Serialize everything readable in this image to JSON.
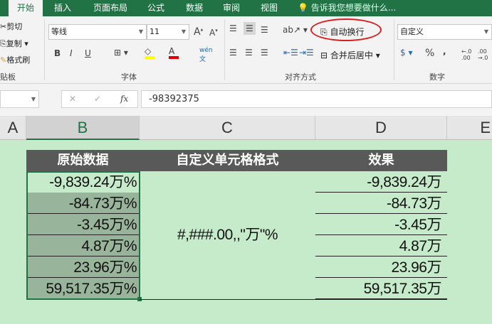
{
  "tabs": [
    "开始",
    "插入",
    "页面布局",
    "公式",
    "数据",
    "审阅",
    "视图"
  ],
  "tell_me": "告诉我您想要做什么...",
  "clipboard": {
    "cut": "剪切",
    "copy": "复制",
    "format_painter": "格式刷",
    "group": "贴板"
  },
  "font": {
    "name": "等线",
    "size": "11",
    "group": "字体",
    "bold": "B",
    "italic": "I",
    "underline": "U",
    "fill_color": "#ffff00",
    "font_color": "#e00000"
  },
  "alignment": {
    "wrap_text": "自动换行",
    "merge_center": "合并后居中",
    "group": "对齐方式"
  },
  "number": {
    "format": "自定义",
    "percent": "%",
    "comma": ",",
    "group": "数字"
  },
  "formula_bar": {
    "value": "-98392375",
    "fx": "fx"
  },
  "columns": [
    "A",
    "B",
    "C",
    "D",
    "E"
  ],
  "table": {
    "headers": [
      "原始数据",
      "自定义单元格格式",
      "效果"
    ],
    "original": [
      "-9,839.24万%",
      "-84.73万%",
      "-3.45万%",
      "4.87万%",
      "23.96万%",
      "59,517.35万%"
    ],
    "format": "#,###.00,,\"万\"%",
    "result": [
      "-9,839.24万",
      "-84.73万",
      "-3.45万",
      "4.87万",
      "23.96万",
      "59,517.35万"
    ]
  },
  "colors": {
    "accent": "#217346",
    "sheet_bg": "#c6ebca",
    "header_bg": "#595959",
    "selection_fill": "#98b49a",
    "annotation": "#e02020"
  }
}
